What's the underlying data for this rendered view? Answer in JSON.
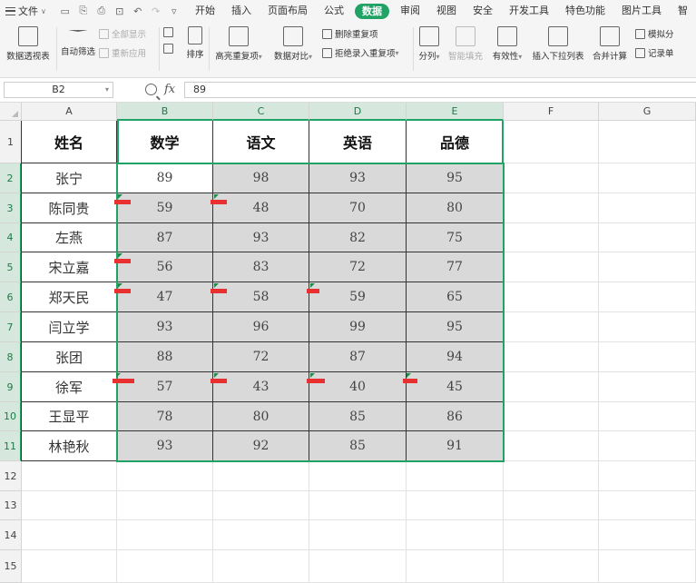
{
  "menubar": {
    "file_label": "文件",
    "tabs": [
      "开始",
      "插入",
      "页面布局",
      "公式",
      "数据",
      "审阅",
      "视图",
      "安全",
      "开发工具",
      "特色功能",
      "图片工具",
      "智"
    ],
    "active_tab": "数据"
  },
  "ribbon": {
    "pivot": "数据透视表",
    "auto_filter": "自动筛选",
    "show_all": "全部显示",
    "reapply": "重新应用",
    "sort": "排序",
    "highlight_dup": "高亮重复项",
    "data_compare": "数据对比",
    "remove_dup": "删除重复项",
    "reject_dup": "拒绝录入重复项",
    "split_col": "分列",
    "smart_fill": "智能填充",
    "validity": "有效性",
    "insert_dropdown": "插入下拉列表",
    "consolidate": "合并计算",
    "simulate": "模拟分",
    "record": "记录单"
  },
  "formula_bar": {
    "name_box": "B2",
    "fx": "fx",
    "value": "89"
  },
  "sheet": {
    "columns": [
      "A",
      "B",
      "C",
      "D",
      "E",
      "F",
      "G"
    ],
    "rows": [
      "1",
      "2",
      "3",
      "4",
      "5",
      "6",
      "7",
      "8",
      "9",
      "10",
      "11",
      "12",
      "13",
      "14",
      "15"
    ],
    "header": [
      "姓名",
      "数学",
      "语文",
      "英语",
      "品德"
    ],
    "data": [
      [
        "张宁",
        "89",
        "98",
        "93",
        "95"
      ],
      [
        "陈同贵",
        "59",
        "48",
        "70",
        "80"
      ],
      [
        "左燕",
        "87",
        "93",
        "82",
        "75"
      ],
      [
        "宋立嘉",
        "56",
        "83",
        "72",
        "77"
      ],
      [
        "郑天民",
        "47",
        "58",
        "59",
        "65"
      ],
      [
        "闫立学",
        "93",
        "96",
        "99",
        "95"
      ],
      [
        "张团",
        "88",
        "72",
        "87",
        "94"
      ],
      [
        "徐军",
        "57",
        "43",
        "40",
        "45"
      ],
      [
        "王显平",
        "78",
        "80",
        "85",
        "86"
      ],
      [
        "林艳秋",
        "93",
        "92",
        "85",
        "91"
      ]
    ],
    "active_cell": "B2",
    "colors": {
      "selection": "#21a366",
      "gray_fill": "#d9d9d9",
      "error_mark": "#e83030"
    }
  }
}
